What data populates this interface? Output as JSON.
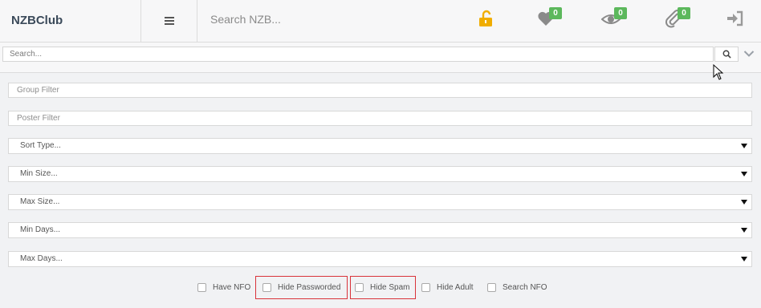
{
  "brand": "NZBClub",
  "header": {
    "search_placeholder": "Search NZB...",
    "icons": [
      {
        "name": "unlock-icon",
        "color": "#f0ad00"
      },
      {
        "name": "heart-icon",
        "badge": "0"
      },
      {
        "name": "eye-icon",
        "badge": "0"
      },
      {
        "name": "paperclip-icon",
        "badge": "0"
      },
      {
        "name": "sign-in-icon"
      }
    ],
    "badge_color": "#5cb85c"
  },
  "search": {
    "placeholder": "Search..."
  },
  "filters": {
    "group_placeholder": "Group Filter",
    "poster_placeholder": "Poster Filter",
    "sort_type": "Sort Type...",
    "min_size": "Min Size...",
    "max_size": "Max Size...",
    "min_days": "Min Days...",
    "max_days": "Max Days..."
  },
  "checkboxes": [
    {
      "label": "Have NFO",
      "checked": false
    },
    {
      "label": "Hide Passworded",
      "checked": false
    },
    {
      "label": "Hide Spam",
      "checked": false
    },
    {
      "label": "Hide Adult",
      "checked": false
    },
    {
      "label": "Search NFO",
      "checked": false
    }
  ]
}
